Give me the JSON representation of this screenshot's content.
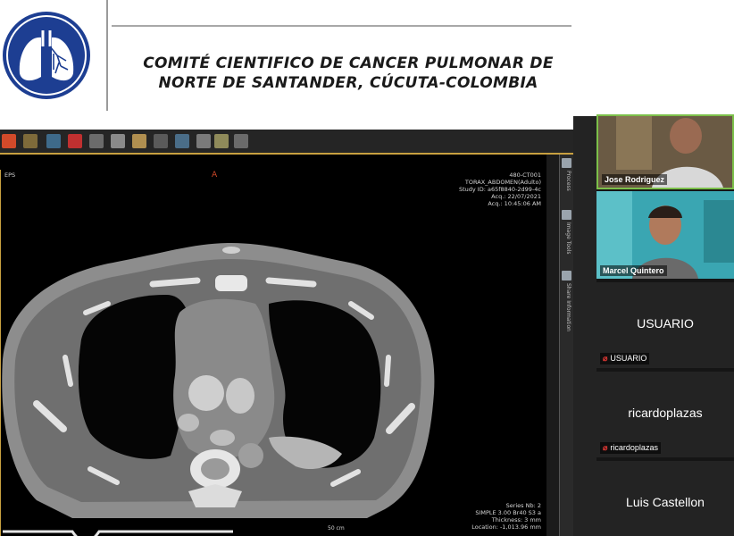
{
  "header": {
    "title_line1": "COMITÉ CIENTIFICO DE CANCER PULMONAR DE",
    "title_line2": "NORTE DE SANTANDER, CÚCUTA-COLOMBIA"
  },
  "viewer": {
    "left_label": "EPS",
    "orientation_marker": "A",
    "header_info": [
      "480-CT001",
      "TORAX_ABDOMEN(Adulto)",
      "Study ID: a65f8840-2d99-4c",
      "Acq.: 22/07/2021",
      "Acq.: 10:45:06 AM"
    ],
    "footer_info": [
      "Series Nb: 2",
      "SIMPLE 3.00 Br40 S3 a",
      "Thickness: 3 mm",
      "Location: -1,013.96 mm"
    ],
    "scale_label": "50 cm",
    "side_tabs": [
      "Process",
      "Image Tools",
      "Share Information"
    ]
  },
  "participants": [
    {
      "name": "Jose Rodriguez",
      "type": "video"
    },
    {
      "name": "Marcel Quintero",
      "type": "video"
    },
    {
      "name": "USUARIO",
      "type": "name",
      "muted": true
    },
    {
      "name": "ricardoplazas",
      "type": "name",
      "muted": true
    },
    {
      "name": "Luis Castellon",
      "type": "name",
      "muted": true
    }
  ],
  "colors": {
    "viewer_border": "#c8a040",
    "logo_blue": "#1d3e92",
    "mute_red": "#e53935"
  },
  "icons": [
    "lungs-logo-icon",
    "mic-muted-icon"
  ]
}
